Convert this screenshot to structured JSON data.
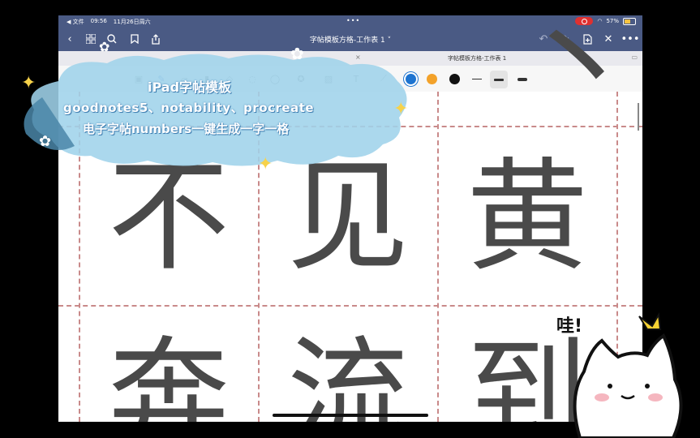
{
  "status": {
    "back_app": "◀ 文件",
    "time": "09:56",
    "date": "11月26日周六",
    "battery": "57%",
    "battery_level": 0.57
  },
  "nav": {
    "title": "字帖模板方格-工作表 1"
  },
  "tab": {
    "title": "字帖模板方格-工作表 1",
    "close": "×"
  },
  "colors": {
    "nav": "#4a5a84",
    "blue": "#1e74d0",
    "orange": "#f3a22a",
    "black": "#111111",
    "grid": "#c98a8a"
  },
  "grid": {
    "top_partial": [
      "",
      "",
      "丶"
    ],
    "row1": [
      "不",
      "见",
      "黄"
    ],
    "row2": [
      "奔",
      "流",
      "到"
    ]
  },
  "banner": {
    "line1": "iPad字帖模板",
    "line2": "goodnotes5、notability、procreate",
    "line3": "电子字帖numbers一键生成一字一格"
  },
  "sticker": {
    "text": "哇!"
  }
}
